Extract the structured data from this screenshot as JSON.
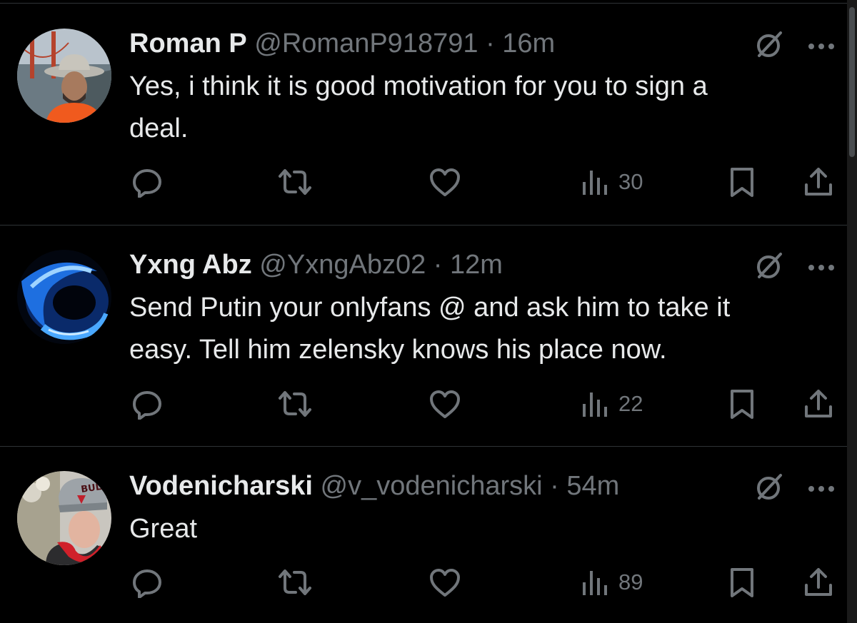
{
  "colors": {
    "background": "#000000",
    "text_primary": "#e7e9ea",
    "text_secondary": "#71767b",
    "divider": "#2f3336"
  },
  "icons": {
    "reply": "reply-icon",
    "repost": "repost-icon",
    "like": "like-icon",
    "views": "views-icon",
    "bookmark": "bookmark-icon",
    "share": "share-icon",
    "grok": "grok-icon",
    "more": "more-icon"
  },
  "tweets": [
    {
      "name": "Roman P",
      "handle": "@RomanP918791",
      "separator": "·",
      "time": "16m",
      "text": "Yes, i think it is good motivation for you to sign a\ndeal.",
      "views": "30"
    },
    {
      "name": "Yxng Abz",
      "handle": "@YxngAbz02",
      "separator": "·",
      "time": "12m",
      "text": "Send Putin your onlyfans @ and ask him to take it\neasy. Tell him zelensky knows his place now.",
      "views": "22"
    },
    {
      "name": "Vodenicharski",
      "handle": "@v_vodenicharski",
      "separator": "·",
      "time": "54m",
      "text": "Great",
      "views": "89"
    }
  ]
}
